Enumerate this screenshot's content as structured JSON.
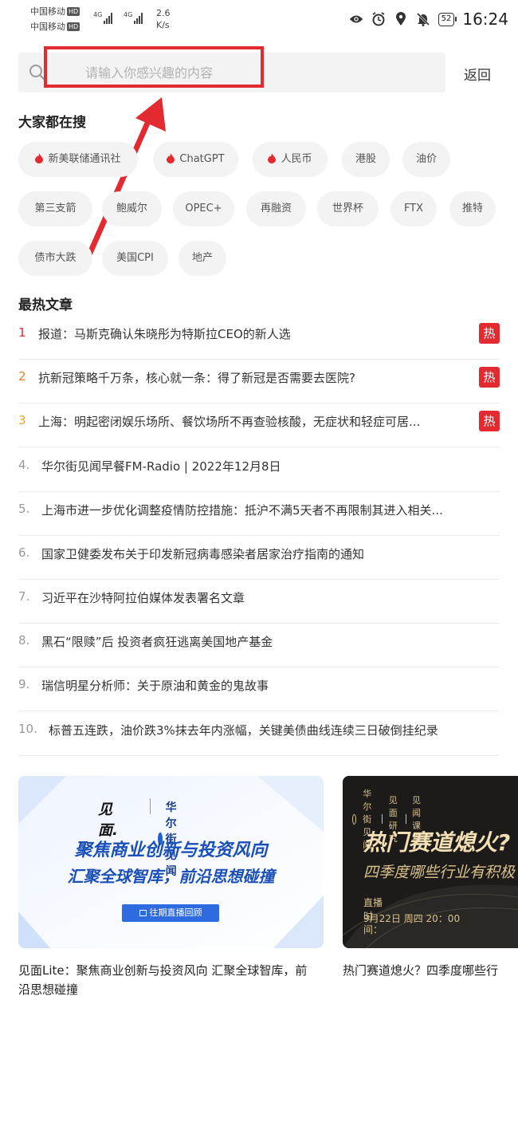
{
  "status_bar": {
    "carrier1": "中国移动",
    "carrier2": "中国移动",
    "hd_label": "HD",
    "net_type": "4G",
    "speed_value": "2.6",
    "speed_unit": "K/s",
    "battery": "52",
    "time": "16:24",
    "icons": [
      "eye-icon",
      "alarm-icon",
      "location-icon",
      "mute-icon"
    ]
  },
  "search": {
    "placeholder": "请输入你感兴趣的内容",
    "back_label": "返回"
  },
  "trending": {
    "title": "大家都在搜",
    "chips": [
      {
        "label": "新美联储通讯社",
        "hot": true
      },
      {
        "label": "ChatGPT",
        "hot": true
      },
      {
        "label": "人民币",
        "hot": true
      },
      {
        "label": "港股",
        "hot": false
      },
      {
        "label": "油价",
        "hot": false
      },
      {
        "label": "第三支箭",
        "hot": false
      },
      {
        "label": "鲍威尔",
        "hot": false
      },
      {
        "label": "OPEC+",
        "hot": false
      },
      {
        "label": "再融资",
        "hot": false
      },
      {
        "label": "世界杯",
        "hot": false
      },
      {
        "label": "FTX",
        "hot": false
      },
      {
        "label": "推特",
        "hot": false
      },
      {
        "label": "债市大跌",
        "hot": false
      },
      {
        "label": "美国CPI",
        "hot": false
      },
      {
        "label": "地产",
        "hot": false
      }
    ]
  },
  "hot_articles": {
    "title": "最热文章",
    "hot_badge": "热",
    "items": [
      {
        "num": "1",
        "title": "报道：马斯克确认朱晓彤为特斯拉CEO的新人选",
        "hot": true
      },
      {
        "num": "2",
        "title": "抗新冠策略千万条，核心就一条：得了新冠是否需要去医院?",
        "hot": true
      },
      {
        "num": "3",
        "title": "上海：明起密闭娱乐场所、餐饮场所不再查验核酸，无症状和轻症可居...",
        "hot": true
      },
      {
        "num": "4.",
        "title": "华尔街见闻早餐FM-Radio | 2022年12月8日",
        "hot": false
      },
      {
        "num": "5.",
        "title": "上海市进一步优化调整疫情防控措施：抵沪不满5天者不再限制其进入相关...",
        "hot": false
      },
      {
        "num": "6.",
        "title": "国家卫健委发布关于印发新冠病毒感染者居家治疗指南的通知",
        "hot": false
      },
      {
        "num": "7.",
        "title": "习近平在沙特阿拉伯媒体发表署名文章",
        "hot": false
      },
      {
        "num": "8.",
        "title": "黑石“限赎”后 投资者疯狂逃离美国地产基金",
        "hot": false
      },
      {
        "num": "9.",
        "title": "瑞信明星分析师：关于原油和黄金的鬼故事",
        "hot": false
      },
      {
        "num": "10.",
        "title": "标普五连跌，油价跌3%抹去年内涨幅，关键美债曲线连续三日破倒挂纪录",
        "hot": false
      }
    ]
  },
  "cards": [
    {
      "logo_text": "见面.",
      "brand": "华尔街见闻",
      "headline1": "聚焦商业创新与投资风向",
      "headline2": "汇聚全球智库，前沿思想碰撞",
      "button_label": "往期直播回顾",
      "caption": "见面Lite：聚焦商业创新与投资风向 汇聚全球智库，前沿思想碰撞"
    },
    {
      "top_brand": "华尔街见闻",
      "top_tag1": "见面研究",
      "top_tag2": "见闻课程",
      "headline": "热门赛道熄火?",
      "subtitle": "四季度哪些行业有积极",
      "live_label": "直播时间：",
      "live_time": "9月22日 周四 20：00",
      "caption": "热门赛道熄火？四季度哪些行"
    }
  ],
  "colors": {
    "accent_red": "#e32a31",
    "rank1": "#e32a31",
    "rank2": "#f07a2a",
    "rank3": "#f0a63a",
    "rank_other": "#999999",
    "chip_bg": "#f3f3f3"
  }
}
